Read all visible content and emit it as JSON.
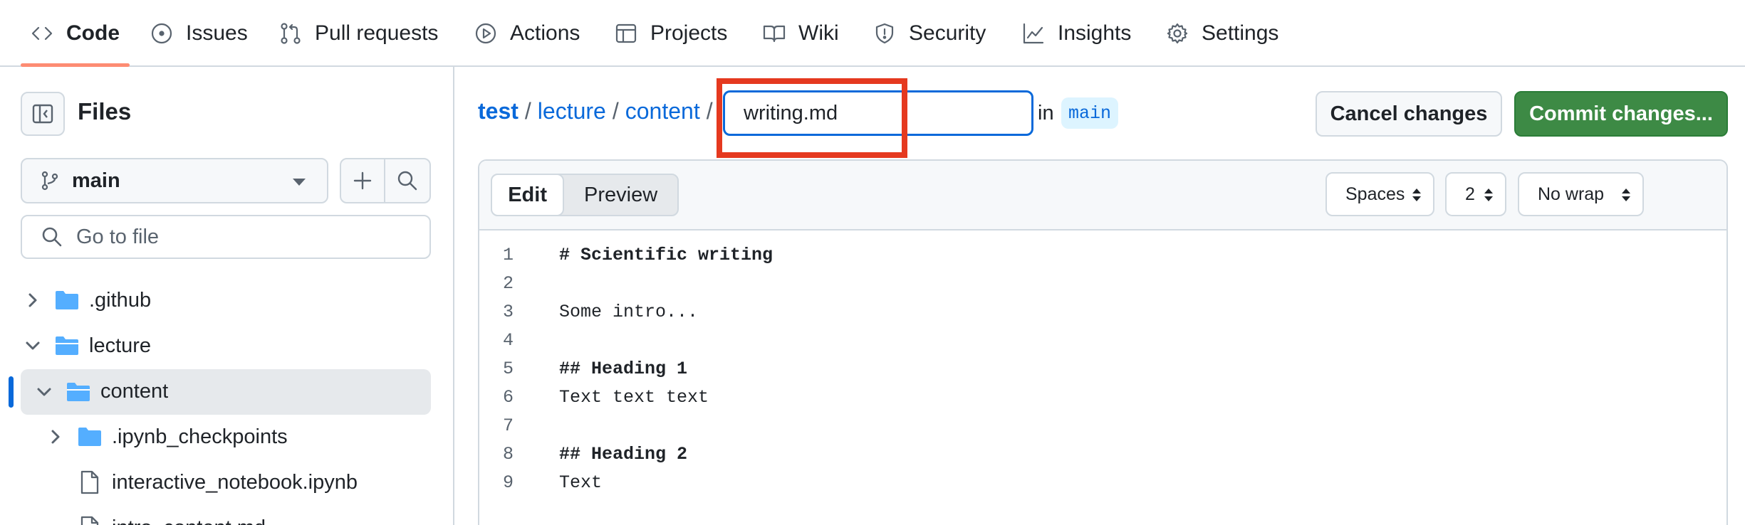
{
  "nav": {
    "tabs": [
      {
        "label": "Code",
        "icon": "code-icon",
        "active": true
      },
      {
        "label": "Issues",
        "icon": "issue-icon"
      },
      {
        "label": "Pull requests",
        "icon": "pull-request-icon"
      },
      {
        "label": "Actions",
        "icon": "play-icon"
      },
      {
        "label": "Projects",
        "icon": "table-icon"
      },
      {
        "label": "Wiki",
        "icon": "book-icon"
      },
      {
        "label": "Security",
        "icon": "shield-icon"
      },
      {
        "label": "Insights",
        "icon": "graph-icon"
      },
      {
        "label": "Settings",
        "icon": "gear-icon"
      }
    ]
  },
  "sidebar": {
    "title": "Files",
    "branch": "main",
    "search_placeholder": "Go to file",
    "tree": [
      {
        "label": ".github",
        "kind": "folder",
        "expanded": false
      },
      {
        "label": "lecture",
        "kind": "folder",
        "expanded": true
      },
      {
        "label": "content",
        "kind": "folder",
        "expanded": true,
        "selected": true
      },
      {
        "label": ".ipynb_checkpoints",
        "kind": "folder",
        "expanded": false
      },
      {
        "label": "interactive_notebook.ipynb",
        "kind": "file"
      },
      {
        "label": "intro_content.md",
        "kind": "file"
      }
    ]
  },
  "breadcrumb": {
    "repo": "test",
    "sep1": "/",
    "dir1": "lecture",
    "sep2": "/",
    "dir2": "content",
    "sep3": "/",
    "filename": "writing.md",
    "in_text": "in",
    "branch": "main"
  },
  "actions": {
    "cancel": "Cancel changes",
    "commit": "Commit changes..."
  },
  "editor": {
    "mode_edit": "Edit",
    "mode_preview": "Preview",
    "indent_mode": "Spaces",
    "indent_size": "2",
    "wrap_mode": "No wrap",
    "lines": [
      {
        "n": "1",
        "text": "# Scientific writing",
        "bold": true
      },
      {
        "n": "2",
        "text": "",
        "bold": false
      },
      {
        "n": "3",
        "text": "Some intro...",
        "bold": false
      },
      {
        "n": "4",
        "text": "",
        "bold": false
      },
      {
        "n": "5",
        "text": "## Heading 1",
        "bold": true
      },
      {
        "n": "6",
        "text": "Text text text",
        "bold": false
      },
      {
        "n": "7",
        "text": "",
        "bold": false
      },
      {
        "n": "8",
        "text": "## Heading 2",
        "bold": true
      },
      {
        "n": "9",
        "text": "Text",
        "bold": false
      }
    ]
  },
  "colors": {
    "accent": "#0969da",
    "commit_green": "#3d8a45",
    "tab_underline": "#fd8c73",
    "annotation_red": "#e5391f",
    "folder_blue": "#54aeff"
  }
}
